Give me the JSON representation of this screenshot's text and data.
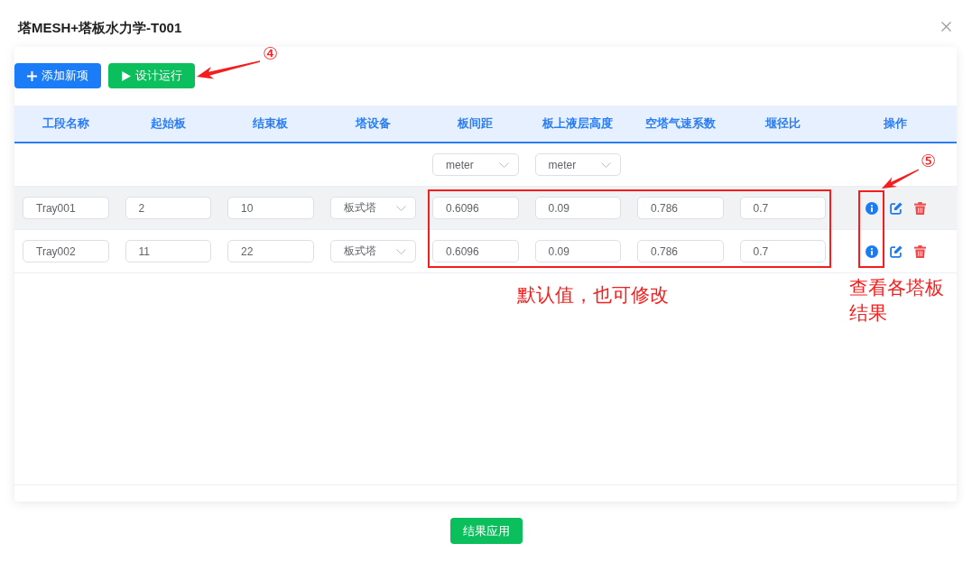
{
  "dialog": {
    "title": "塔MESH+塔板水力学-T001"
  },
  "toolbar": [
    {
      "kind": "add",
      "label": "添加新项"
    },
    {
      "kind": "run",
      "label": "设计运行"
    }
  ],
  "table": {
    "columns": [
      {
        "label": "工段名称"
      },
      {
        "label": "起始板"
      },
      {
        "label": "结束板"
      },
      {
        "label": "塔设备"
      },
      {
        "label": "板间距",
        "unit": "meter"
      },
      {
        "label": "板上液层高度",
        "unit": "meter"
      },
      {
        "label": "空塔气速系数"
      },
      {
        "label": "堰径比"
      },
      {
        "label": "操作"
      }
    ],
    "rows": [
      {
        "hovered": true,
        "cells": [
          {
            "kind": "input",
            "value": "Tray001"
          },
          {
            "kind": "input",
            "value": "2"
          },
          {
            "kind": "input",
            "value": "10"
          },
          {
            "kind": "select",
            "value": "板式塔"
          },
          {
            "kind": "input",
            "value": "0.6096"
          },
          {
            "kind": "input",
            "value": "0.09"
          },
          {
            "kind": "input",
            "value": "0.786"
          },
          {
            "kind": "input",
            "value": "0.7"
          }
        ]
      },
      {
        "hovered": false,
        "cells": [
          {
            "kind": "input",
            "value": "Tray002"
          },
          {
            "kind": "input",
            "value": "11"
          },
          {
            "kind": "input",
            "value": "22"
          },
          {
            "kind": "select",
            "value": "板式塔"
          },
          {
            "kind": "input",
            "value": "0.6096"
          },
          {
            "kind": "input",
            "value": "0.09"
          },
          {
            "kind": "input",
            "value": "0.786"
          },
          {
            "kind": "input",
            "value": "0.7"
          }
        ]
      }
    ]
  },
  "footer": {
    "button": {
      "kind": "apply",
      "label": "结果应用"
    }
  },
  "annotations": {
    "markers": [
      "④",
      "⑤"
    ],
    "notes": [
      "默认值，也可修改",
      "查看各塔板结果"
    ]
  }
}
